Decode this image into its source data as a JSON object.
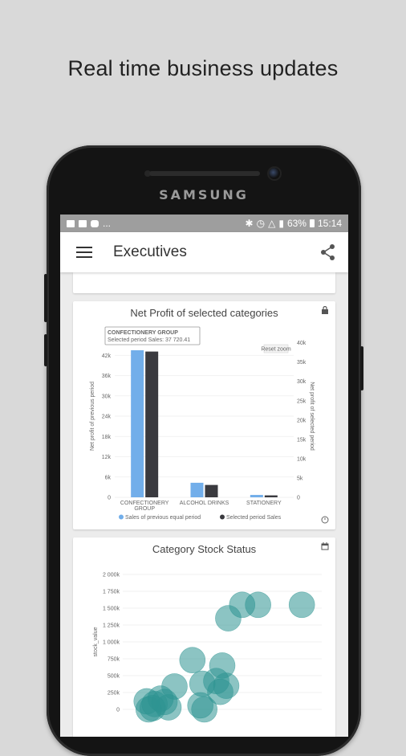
{
  "headline": "Real time business updates",
  "phone": {
    "brand": "SAMSUNG"
  },
  "status_bar": {
    "left_more": "...",
    "battery": "63%",
    "time": "15:14"
  },
  "app_bar": {
    "title": "Executives"
  },
  "icons": {
    "menu": "menu-icon",
    "share": "share-icon",
    "lock": "lock-icon",
    "calendar": "calendar-icon",
    "refresh": "refresh-icon"
  },
  "colors": {
    "series_prev": "#72aeea",
    "series_sel": "#3a3a3f",
    "bubble": "#2d9491"
  },
  "card1": {
    "title": "Net Profit of selected categories"
  },
  "card2": {
    "title": "Category Stock Status"
  },
  "chart_data": [
    {
      "type": "bar",
      "title": "Net Profit of selected categories",
      "categories": [
        "CONFECTIONERY GROUP",
        "ALCOHOL DRINKS",
        "STATIONERY"
      ],
      "series": [
        {
          "name": "Sales of previous equal period",
          "values": [
            43500,
            4300,
            700
          ],
          "axis": "left"
        },
        {
          "name": "Selected period Sales",
          "values": [
            37720.41,
            3200,
            500
          ],
          "axis": "right"
        }
      ],
      "ylabel": "Net profit of previous period",
      "ylabel_right": "Net profit of selected period",
      "ylim": [
        0,
        48000
      ],
      "ylim_right": [
        0,
        42000
      ],
      "yticks": [
        "0",
        "6k",
        "12k",
        "18k",
        "24k",
        "30k",
        "36k",
        "42k"
      ],
      "yticks_right": [
        "0",
        "5k",
        "10k",
        "15k",
        "20k",
        "25k",
        "30k",
        "35k",
        "40k"
      ],
      "tooltip": {
        "title": "CONFECTIONERY GROUP",
        "text": "Selected period Sales: 37 720.41"
      },
      "reset_label": "Reset zoom",
      "legend": "bottom"
    },
    {
      "type": "scatter",
      "title": "Category Stock Status",
      "ylabel": "stock_value",
      "ylim": [
        0,
        2000000
      ],
      "yticks": [
        "0",
        "250k",
        "500k",
        "750k",
        "1 000k",
        "1 250k",
        "1 500k",
        "1 750k",
        "2 000k"
      ],
      "x": [
        0.13,
        0.16,
        0.19,
        0.23,
        0.26,
        0.12,
        0.35,
        0.4,
        0.41,
        0.47,
        0.5,
        0.52,
        0.53,
        0.6,
        0.68,
        0.9,
        0.15,
        0.21,
        0.39,
        0.49
      ],
      "y": [
        0,
        80000,
        160000,
        30000,
        340000,
        120000,
        730000,
        380000,
        0,
        420000,
        650000,
        350000,
        1350000,
        1550000,
        1550000,
        1550000,
        20000,
        110000,
        60000,
        260000
      ]
    }
  ]
}
